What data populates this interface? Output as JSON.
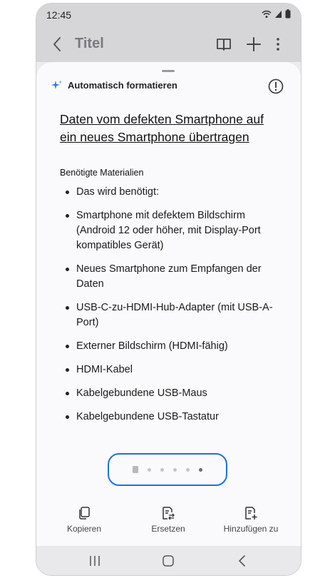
{
  "status": {
    "time": "12:45"
  },
  "appbar": {
    "title": "Titel",
    "actions": [
      "book-icon",
      "plus-icon",
      "more-vert-icon"
    ]
  },
  "sheet": {
    "auto_format_label": "Automatisch formatieren",
    "note_title": "Daten vom defekten Smartphone auf ein neues Smartphone übertragen",
    "section_title": "Benötigte Materialien",
    "items": [
      "Das wird benötigt:",
      "Smartphone mit defektem Bildschirm (Android 12 oder höher, mit Display-Port kompatibles Gerät)",
      "Neues Smartphone zum Empfangen der Daten",
      "USB-C-zu-HDMI-Hub-Adapter (mit USB-A-Port)",
      "Externer Bildschirm (HDMI-fähig)",
      "HDMI-Kabel",
      "Kabelgebundene USB-Maus",
      "Kabelgebundene USB-Tastatur"
    ],
    "pager": {
      "pages": 6,
      "active_index": 5
    }
  },
  "bottom_actions": {
    "copy": "Kopieren",
    "replace": "Ersetzen",
    "add_to": "Hinzufügen zu"
  },
  "colors": {
    "accent": "#1f6fe0",
    "appbar": "#d6d6d8"
  }
}
